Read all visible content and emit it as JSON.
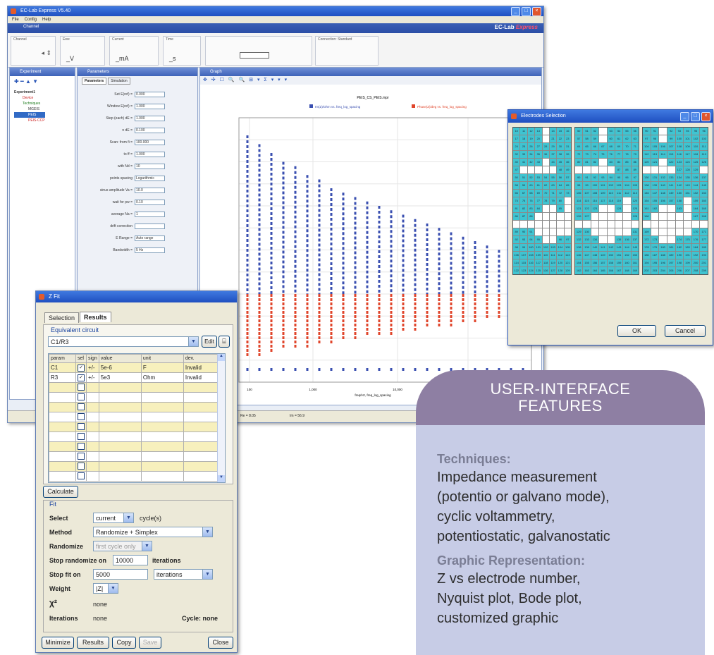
{
  "main_window": {
    "title": "EC-Lab Express V5.40",
    "menu": [
      "File",
      "Config",
      "Help"
    ],
    "banner_label": "Channel",
    "brand_main": "EC-Lab",
    "brand_sub": "Express",
    "status": {
      "channel_cap": "Channel",
      "ewe_cap": "Ewe",
      "ewe_unit": "_V",
      "current_cap": "Current",
      "current_unit": "_mA",
      "time_cap": "Time",
      "time_unit": "_s",
      "connection_label": "Connection: Standard"
    },
    "experiment_panel": {
      "title": "Experiment",
      "tree": [
        "Experiment1",
        "Device",
        "Techniques",
        "MGEIS",
        "PEIS",
        "PEIS-CCP"
      ]
    },
    "parameters_panel": {
      "title": "Parameters",
      "tabs": [
        "Parameters",
        "Simulation"
      ],
      "rows": [
        {
          "label": "Set E(ref) =",
          "value": "0.000"
        },
        {
          "label": "Window E(ref) =",
          "value": "1.000"
        },
        {
          "label": "Step (each) dE =",
          "value": "1.000"
        },
        {
          "label": "n dE =",
          "value": "0.100"
        },
        {
          "label": "Scan: from fi =",
          "value": "100.000"
        },
        {
          "label": "to ff =",
          "value": "1.000"
        },
        {
          "label": "with Nd =",
          "value": "10"
        },
        {
          "label": "points spacing",
          "value": "Logarithmic"
        },
        {
          "label": "sinus amplitude Va =",
          "value": "10.0"
        },
        {
          "label": "wait for pw =",
          "value": "0.10"
        },
        {
          "label": "average Na =",
          "value": "1"
        },
        {
          "label": "drift correction",
          "value": ""
        },
        {
          "label": "E Range =",
          "value": "Auto range"
        },
        {
          "label": "Bandwidth =",
          "value": "5 Hz"
        }
      ]
    },
    "graph_panel": {
      "title": "Graph",
      "status_cells": [
        "Re = 8.05",
        "Im = 56.9"
      ]
    }
  },
  "chart_data": {
    "type": "scatter",
    "title": "PEIS_CS_PEIS.mpr",
    "legend": [
      "Im(Z)/Ohm vs. freq_log_spacing",
      "Phase(Z)/deg vs. freq_log_spacing"
    ],
    "xlabel": "freq/Hz, freq_log_spacing",
    "x_scale": "log",
    "x_ticks": [
      "100",
      "1,000",
      "10,000"
    ],
    "series": [
      {
        "name": "Im(Z)/Ohm vs. freq_log_spacing",
        "color": "#3a4fb0",
        "values": [
          1.6,
          1.5,
          1.4,
          1.3,
          1.25,
          1.15,
          1.1,
          1.0,
          0.95,
          0.9,
          0.85,
          0.8,
          0.75,
          0.7,
          0.65,
          0.6,
          0.55,
          0.5,
          0.45,
          0.4,
          0.35,
          0.3,
          0.25,
          0.2
        ]
      },
      {
        "name": "Phase(Z)/deg vs. freq_log_spacing",
        "color": "#e0452b",
        "values": [
          -0.9,
          -0.88,
          -0.85,
          -0.82,
          -0.8,
          -0.78,
          -0.76,
          -0.74,
          -0.72,
          -0.7,
          -0.68,
          -0.66,
          -0.64,
          -0.62,
          -0.6,
          -0.58,
          -0.56,
          -0.54,
          -0.52,
          -0.5,
          -0.48,
          -0.46,
          -0.44,
          -0.42
        ]
      }
    ]
  },
  "fit_window": {
    "title": "Z Fit",
    "tabs": [
      "Selection",
      "Results"
    ],
    "circuit_label": "Equivalent circuit",
    "circuit": "C1/R3",
    "edit_label": "Edit",
    "table_headers": [
      "param",
      "sel",
      "sign",
      "value",
      "unit",
      "dev."
    ],
    "rows": [
      {
        "param": "C1",
        "sign": "+/-",
        "value": "5e-6",
        "unit": "F",
        "dev": "Invalid"
      },
      {
        "param": "R3",
        "sign": "+/-",
        "value": "5e3",
        "unit": "Ohm",
        "dev": "Invalid"
      }
    ],
    "calculate_label": "Calculate",
    "fit_group": "Fit",
    "select_label": "Select",
    "select_value": "current",
    "select_option": "cycle(s)",
    "method_label": "Method",
    "method_value": "Randomize + Simplex",
    "randomize_label": "Randomize",
    "randomize_value": "first cycle only",
    "stop_randomize_label": "Stop randomize on",
    "stop_randomize_value": "10000",
    "iterations_label": "iterations",
    "stop_fit_label": "Stop fit on",
    "stop_fit_value": "5000",
    "stop_fit_unit": "iterations",
    "weight_label": "Weight",
    "weight_value": "|Z|",
    "chi_label": "χ²",
    "chi_value": "none",
    "iterations_row_label": "Iterations",
    "iterations_value": "none",
    "cycle_label": "Cycle: none",
    "buttons": [
      "Minimize",
      "Results",
      "Copy",
      "Save",
      "Close"
    ]
  },
  "electrode_window": {
    "title": "Electrodes Selection",
    "ok_label": "OK",
    "cancel_label": "Cancel"
  },
  "features": {
    "heading_line1": "USER-INTERFACE",
    "heading_line2": "FEATURES",
    "techniques_label": "Techniques:",
    "techniques_lines": [
      "Impedance measurement",
      "(potentio or galvano mode),",
      "cyclic voltammetry,",
      "potentiostatic, galvanostatic"
    ],
    "graphic_label": "Graphic Representation:",
    "graphic_lines": [
      "Z vs electrode number,",
      "Nyquist plot, Bode plot,",
      "customized graphic"
    ]
  },
  "colors": {
    "accent_blue": "#2b4ea6",
    "cyan_cell": "#3fc4d1",
    "feature_purple": "#8e7fa3",
    "feature_body": "#c7cce6"
  }
}
